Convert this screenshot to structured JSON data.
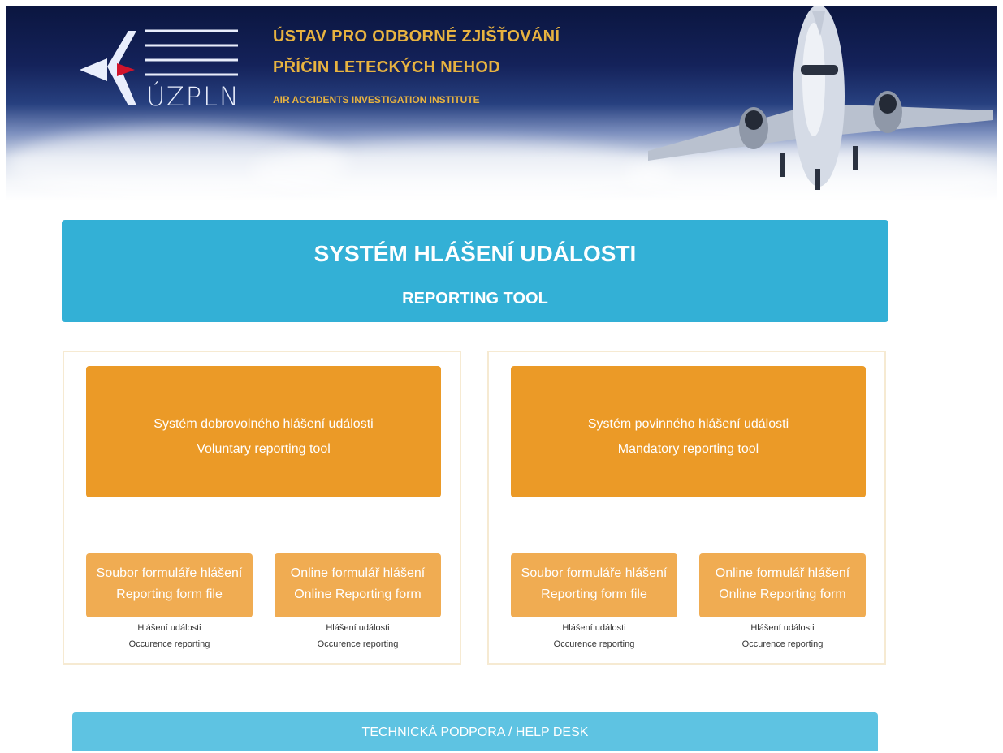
{
  "header": {
    "logo_text": "ÚZPLN",
    "org_name_line1": "ÚSTAV PRO ODBORNÉ ZJIŠŤOVÁNÍ",
    "org_name_line2": "PŘÍČIN LETECKÝCH NEHOD",
    "org_name_en": "AIR ACCIDENTS INVESTIGATION INSTITUTE"
  },
  "title": {
    "cz": "SYSTÉM HLÁŠENÍ UDÁLOSTI",
    "en": "REPORTING TOOL"
  },
  "panels": [
    {
      "main_button": {
        "line1": "Systém dobrovolného hlášení události",
        "line2": "Voluntary reporting tool"
      },
      "buttons": [
        {
          "line1": "Soubor formuláře hlášení",
          "line2": "Reporting form file",
          "caption1": "Hlášení události",
          "caption2": "Occurence reporting"
        },
        {
          "line1": "Online formulář hlášení",
          "line2": "Online Reporting form",
          "caption1": "Hlášení události",
          "caption2": "Occurence reporting"
        }
      ]
    },
    {
      "main_button": {
        "line1": "Systém povinného hlášení události",
        "line2": "Mandatory reporting tool"
      },
      "buttons": [
        {
          "line1": "Soubor formuláře hlášení",
          "line2": "Reporting form file",
          "caption1": "Hlášení události",
          "caption2": "Occurence reporting"
        },
        {
          "line1": "Online formulář hlášení",
          "line2": "Online Reporting form",
          "caption1": "Hlášení události",
          "caption2": "Occurence reporting"
        }
      ]
    }
  ],
  "help_desk": "TECHNICKÁ PODPORA / HELP DESK",
  "colors": {
    "title_bar": "#33b0d6",
    "main_button": "#eb9a27",
    "small_button": "#f0ac52",
    "help_bar": "#5ec3e2",
    "org_text": "#e8b340"
  }
}
